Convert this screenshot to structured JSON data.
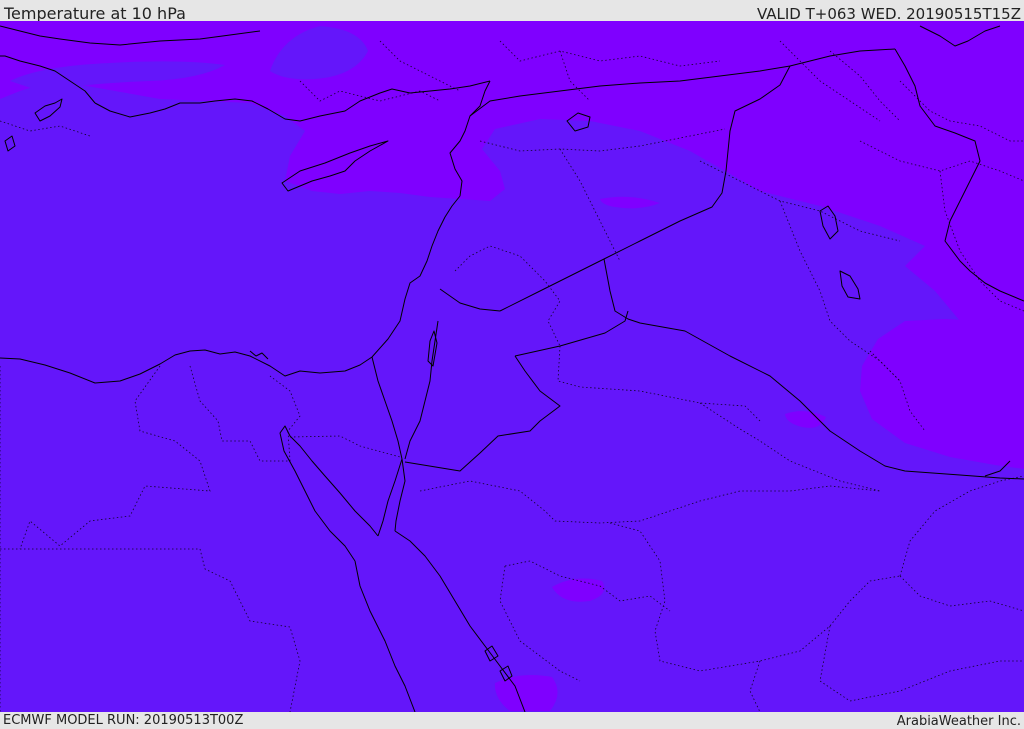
{
  "header": {
    "title": "Temperature at 10 hPa",
    "valid_time": "VALID T+063 WED. 20190515T15Z"
  },
  "footer": {
    "model_run": "ECMWF MODEL RUN: 20190513T00Z",
    "provider": "ArabiaWeather Inc."
  },
  "colors": {
    "base_field": "#6416fa",
    "warm_field": "#7f00ff",
    "border": "#000000",
    "bar_background": "#e6e6e6"
  }
}
